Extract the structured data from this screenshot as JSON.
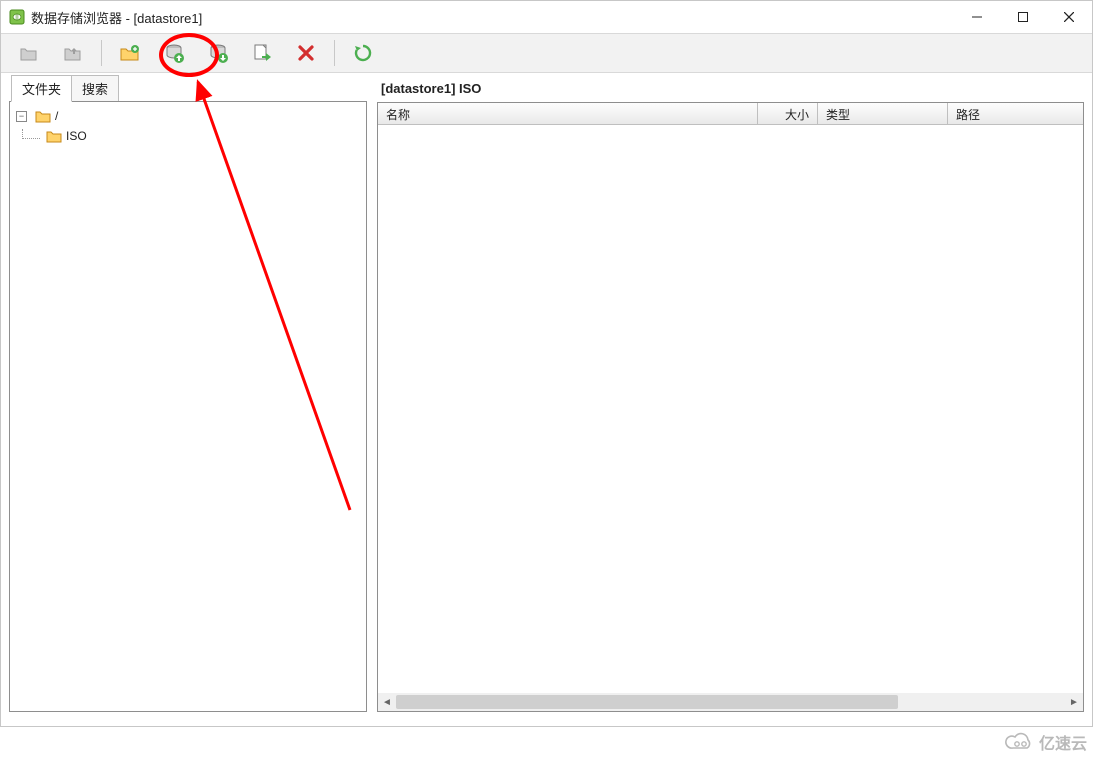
{
  "title": "数据存储浏览器 - [datastore1]",
  "toolbar_icons": {
    "back": "back-icon",
    "forward": "forward-icon",
    "new_folder": "new-folder-icon",
    "upload": "upload-icon",
    "download": "download-icon",
    "copy": "copy-icon",
    "delete": "delete-icon",
    "refresh": "refresh-icon"
  },
  "left_panel": {
    "tabs": [
      {
        "label": "文件夹",
        "active": true
      },
      {
        "label": "搜索",
        "active": false
      }
    ],
    "tree": {
      "root": {
        "label": "/",
        "expanded": true
      },
      "children": [
        {
          "label": "ISO"
        }
      ]
    }
  },
  "right_panel": {
    "path": "[datastore1] ISO",
    "columns": {
      "name": "名称",
      "size": "大小",
      "type": "类型",
      "path": "路径"
    },
    "rows": []
  },
  "watermark": "亿速云"
}
